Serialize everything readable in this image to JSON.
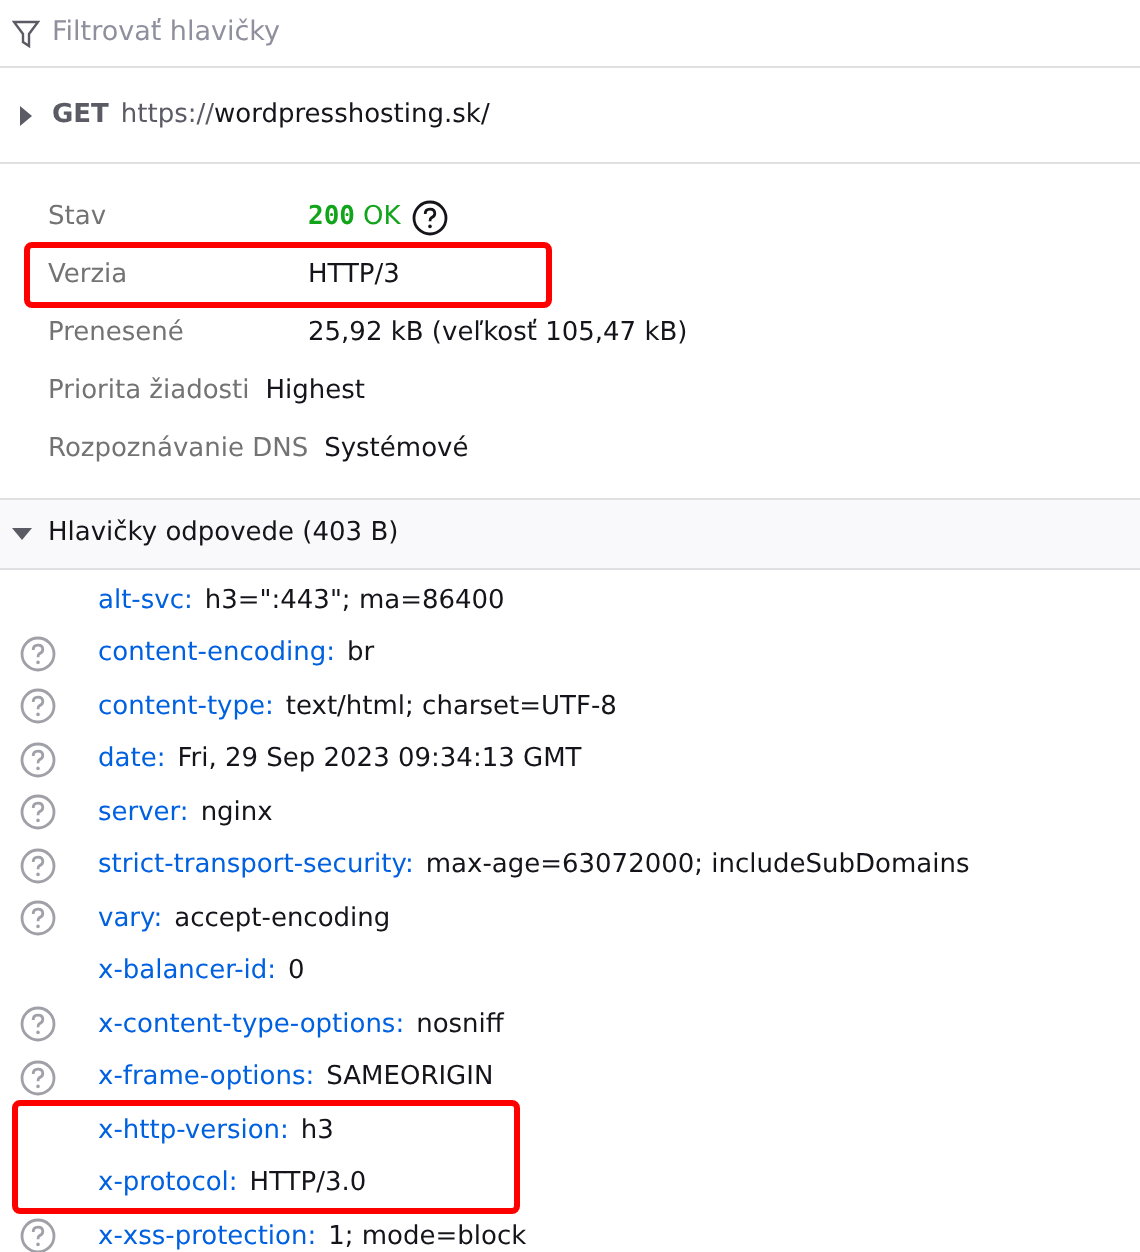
{
  "filter": {
    "placeholder": "Filtrovať hlavičky"
  },
  "request": {
    "expanded": false,
    "method": "GET",
    "scheme": "https://",
    "host": "wordpresshosting.sk/"
  },
  "summary": [
    {
      "kind": "status",
      "label": "Stav",
      "code": "200",
      "text": "OK",
      "help": true,
      "highlighted": false
    },
    {
      "kind": "text",
      "label": "Verzia",
      "value": "HTTP/3",
      "highlighted": true
    },
    {
      "kind": "text",
      "label": "Prenesené",
      "value": "25,92 kB (veľkosť 105,47 kB)",
      "highlighted": false
    },
    {
      "kind": "text",
      "label": "Priorita žiadosti",
      "value": "Highest",
      "highlighted": false
    },
    {
      "kind": "text",
      "label": "Rozpoznávanie DNS",
      "value": "Systémové",
      "highlighted": false
    }
  ],
  "response_headers": {
    "title": "Hlavičky odpovede (403 B)",
    "expanded": true,
    "headers": [
      {
        "name": "alt-svc:",
        "value": "h3=\":443\"; ma=86400",
        "help": false,
        "highlighted": false
      },
      {
        "name": "content-encoding:",
        "value": "br",
        "help": true,
        "highlighted": false
      },
      {
        "name": "content-type:",
        "value": "text/html; charset=UTF-8",
        "help": true,
        "highlighted": false
      },
      {
        "name": "date:",
        "value": "Fri, 29 Sep 2023 09:34:13 GMT",
        "help": true,
        "highlighted": false
      },
      {
        "name": "server:",
        "value": "nginx",
        "help": true,
        "highlighted": false
      },
      {
        "name": "strict-transport-security:",
        "value": "max-age=63072000; includeSubDomains",
        "help": true,
        "highlighted": false
      },
      {
        "name": "vary:",
        "value": "accept-encoding",
        "help": true,
        "highlighted": false
      },
      {
        "name": "x-balancer-id:",
        "value": "0",
        "help": false,
        "highlighted": false
      },
      {
        "name": "x-content-type-options:",
        "value": "nosniff",
        "help": true,
        "highlighted": false
      },
      {
        "name": "x-frame-options:",
        "value": "SAMEORIGIN",
        "help": true,
        "highlighted": false
      },
      {
        "name": "x-http-version:",
        "value": "h3",
        "help": false,
        "highlighted": true
      },
      {
        "name": "x-protocol:",
        "value": "HTTP/3.0",
        "help": false,
        "highlighted": true
      },
      {
        "name": "x-xss-protection:",
        "value": "1; mode=block",
        "help": true,
        "highlighted": false
      }
    ]
  }
}
